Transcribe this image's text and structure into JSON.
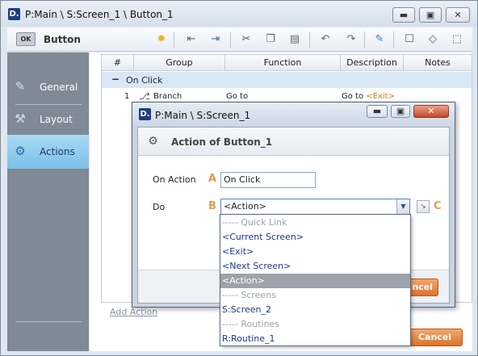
{
  "window": {
    "logo": "D.",
    "title": "P:Main \\ S:Screen_1 \\ Button_1",
    "controls": [
      "minimize-icon",
      "maximize-icon",
      "close-icon"
    ]
  },
  "toolbar": {
    "ok_icon_text": "OK",
    "title": "Button",
    "icons": [
      "lightbulb-icon",
      "outdent-icon",
      "indent-icon",
      "cut-icon",
      "copy-icon",
      "paste-icon",
      "undo-icon",
      "redo-icon",
      "comment-icon",
      "comments-icon",
      "tag-icon",
      "expand-icon"
    ]
  },
  "sidebar": {
    "items": [
      {
        "label": "General",
        "icon": "pencil-icon"
      },
      {
        "label": "Layout",
        "icon": "wrench-icon"
      },
      {
        "label": "Actions",
        "icon": "gears-icon",
        "active": true
      }
    ]
  },
  "grid": {
    "columns": [
      "#",
      "Group",
      "Function",
      "Description",
      "Notes"
    ],
    "group_toggle": "−",
    "group_label": "On Click",
    "rows": [
      {
        "num": "1",
        "group": "Branch",
        "function": "Go to",
        "description_prefix": "Go to ",
        "description_tag": "<Exit>",
        "notes": ""
      }
    ],
    "add_action": "Add Action"
  },
  "main_buttons": {
    "cancel": "Cancel"
  },
  "dialog": {
    "logo": "D.",
    "title": "P:Main \\ S:Screen_1",
    "heading": "Action of Button_1",
    "on_action_label": "On Action",
    "on_action_letter": "A",
    "on_action_value": "On Click",
    "do_label": "Do",
    "do_letter": "B",
    "do_value": "<Action>",
    "c_letter": "C",
    "footer_cancel": "ncel"
  },
  "dropdown": {
    "items": [
      {
        "label": "----- Quick Link",
        "type": "header"
      },
      {
        "label": "<Current Screen>",
        "type": "item"
      },
      {
        "label": "<Exit>",
        "type": "item"
      },
      {
        "label": "<Next Screen>",
        "type": "item"
      },
      {
        "label": "<Action>",
        "type": "selected"
      },
      {
        "label": "----- Screens",
        "type": "header"
      },
      {
        "label": "S:Screen_2",
        "type": "item"
      },
      {
        "label": "----- Routines",
        "type": "header"
      },
      {
        "label": "R:Routine_1",
        "type": "item"
      }
    ]
  },
  "colors": {
    "accent_orange": "#e39a4a",
    "button_orange": "#d9742e",
    "sidebar_bg": "#7f8a96",
    "sidebar_active": "#8fcaec",
    "group_row_bg": "#d9e7f5"
  }
}
